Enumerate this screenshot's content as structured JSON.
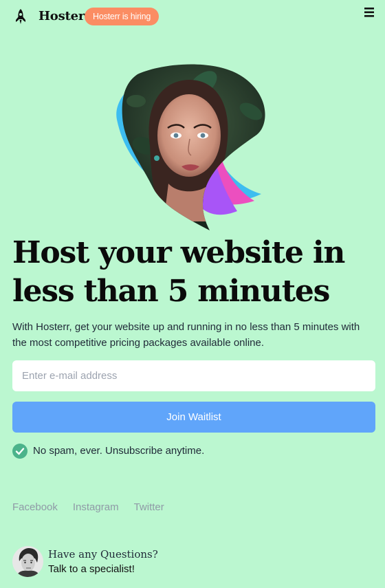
{
  "header": {
    "brand": "Hosterr",
    "badge": "Hosterr is hiring",
    "logo_icon": "rocket-icon",
    "menu_icon": "hamburger-menu-icon"
  },
  "hero": {
    "image_icon": "woman-portrait-blob-illustration",
    "headline": "Host your website in less than 5 minutes",
    "description": "With Hosterr, get your website up and running in no less than 5 minutes with the most competitive pricing packages available online."
  },
  "form": {
    "email_placeholder": "Enter e-mail address",
    "email_value": "",
    "submit_label": "Join Waitlist",
    "nospam": "No spam, ever. Unsubscribe anytime.",
    "nospam_icon": "check-circle-icon"
  },
  "social": {
    "links": [
      "Facebook",
      "Instagram",
      "Twitter"
    ]
  },
  "contact": {
    "question": "Have any Questions?",
    "cta": "Talk to a specialist!",
    "avatar_icon": "specialist-avatar"
  },
  "colors": {
    "background": "#bbf7d0",
    "badge": "#fb8d63",
    "button": "#60a5fa",
    "check": "#4bb38b",
    "social_link": "#8f9aa6",
    "blob_blue": "#3dbdf0",
    "blob_pink": "#ec4fbf",
    "blob_purple": "#a855f7"
  }
}
